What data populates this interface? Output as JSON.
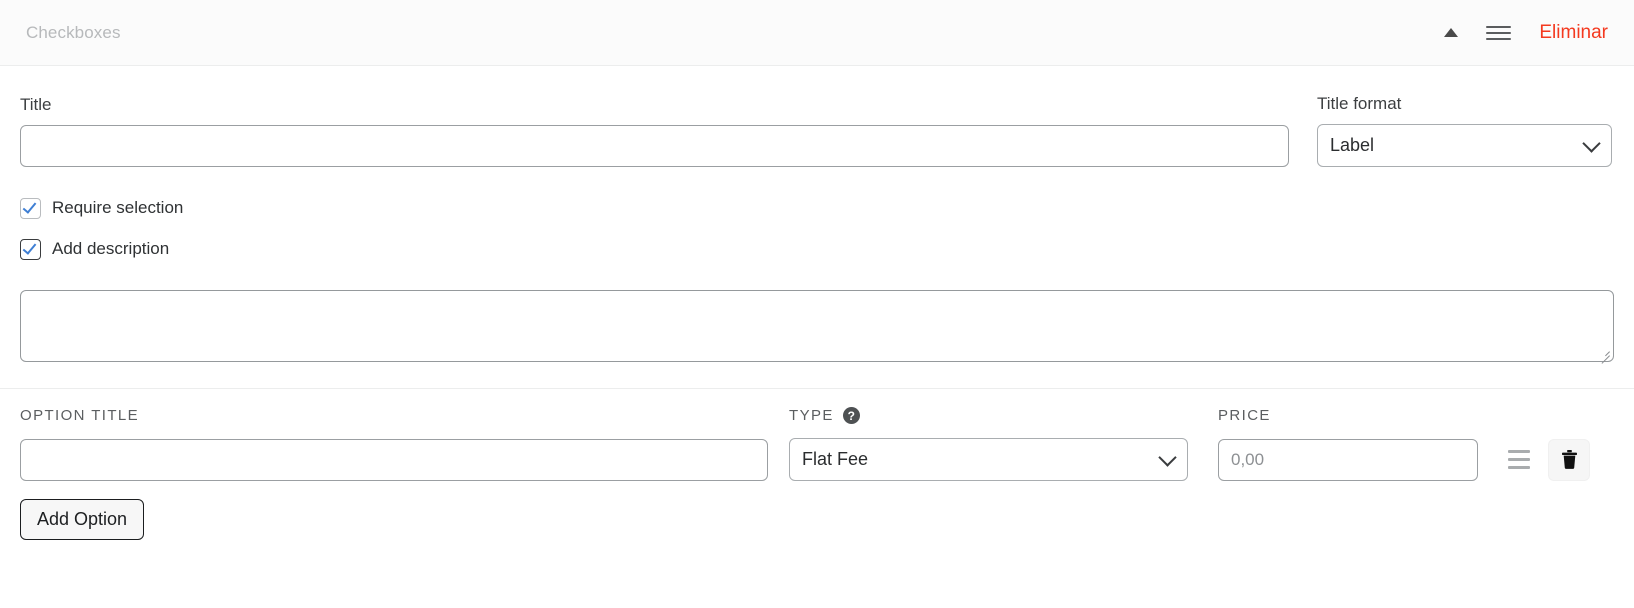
{
  "header": {
    "title": "Checkboxes",
    "collapse_icon": "caret-up-icon",
    "drag_icon": "hamburger-drag-icon",
    "delete_label": "Eliminar"
  },
  "title_section": {
    "title_label": "Title",
    "title_value": "",
    "title_placeholder": "",
    "title_format_label": "Title format",
    "title_format_value": "Label",
    "title_format_options": [
      "Label"
    ]
  },
  "checkboxes": [
    {
      "label": "Require selection",
      "checked": true
    },
    {
      "label": "Add description",
      "checked": true
    }
  ],
  "description": {
    "value": "",
    "placeholder": ""
  },
  "options_table": {
    "columns": {
      "option_title": "OPTION TITLE",
      "type": "TYPE",
      "type_help_icon": "help-circle-icon",
      "price": "PRICE"
    },
    "rows": [
      {
        "option_title_value": "",
        "option_title_placeholder": "",
        "type_value": "Flat Fee",
        "type_options": [
          "Flat Fee"
        ],
        "price_value": "",
        "price_placeholder": "0,00",
        "drag_icon": "drag-handle-icon",
        "delete_icon": "trash-icon"
      }
    ]
  },
  "add_option": {
    "label": "Add Option"
  },
  "colors": {
    "delete_red": "#f4391f",
    "checkbox_blue": "#3f7fd4",
    "header_bg": "#fbfbfb"
  }
}
